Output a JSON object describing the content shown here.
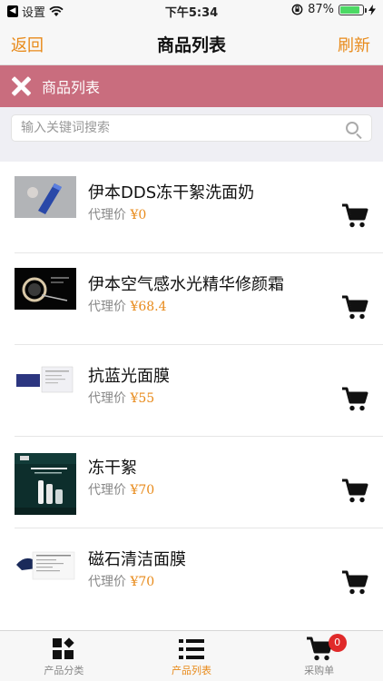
{
  "status_bar": {
    "carrier": "设置",
    "time": "下午5:34",
    "battery": "87%",
    "battery_level": 0.87
  },
  "navbar": {
    "back_label": "返回",
    "title": "商品列表",
    "refresh_label": "刷新"
  },
  "banner": {
    "title": "商品列表"
  },
  "search": {
    "placeholder": "输入关键词搜索",
    "value": ""
  },
  "price_label": "代理价",
  "products": [
    {
      "name": "伊本DDS冻干絮洗面奶",
      "price": "¥0"
    },
    {
      "name": "伊本空气感水光精华修颜霜",
      "price": "¥68.4"
    },
    {
      "name": "抗蓝光面膜",
      "price": "¥55"
    },
    {
      "name": "冻干絮",
      "price": "¥70"
    },
    {
      "name": "磁石清洁面膜",
      "price": "¥70"
    }
  ],
  "tabbar": {
    "tabs": [
      {
        "label": "产品分类",
        "icon": "grid-icon"
      },
      {
        "label": "产品列表",
        "icon": "list-icon",
        "active": true
      },
      {
        "label": "采购单",
        "icon": "cart-icon",
        "badge": "0"
      }
    ]
  },
  "colors": {
    "accent": "#e88a1a",
    "banner": "#c96d7e",
    "badge": "#e02a2a"
  }
}
